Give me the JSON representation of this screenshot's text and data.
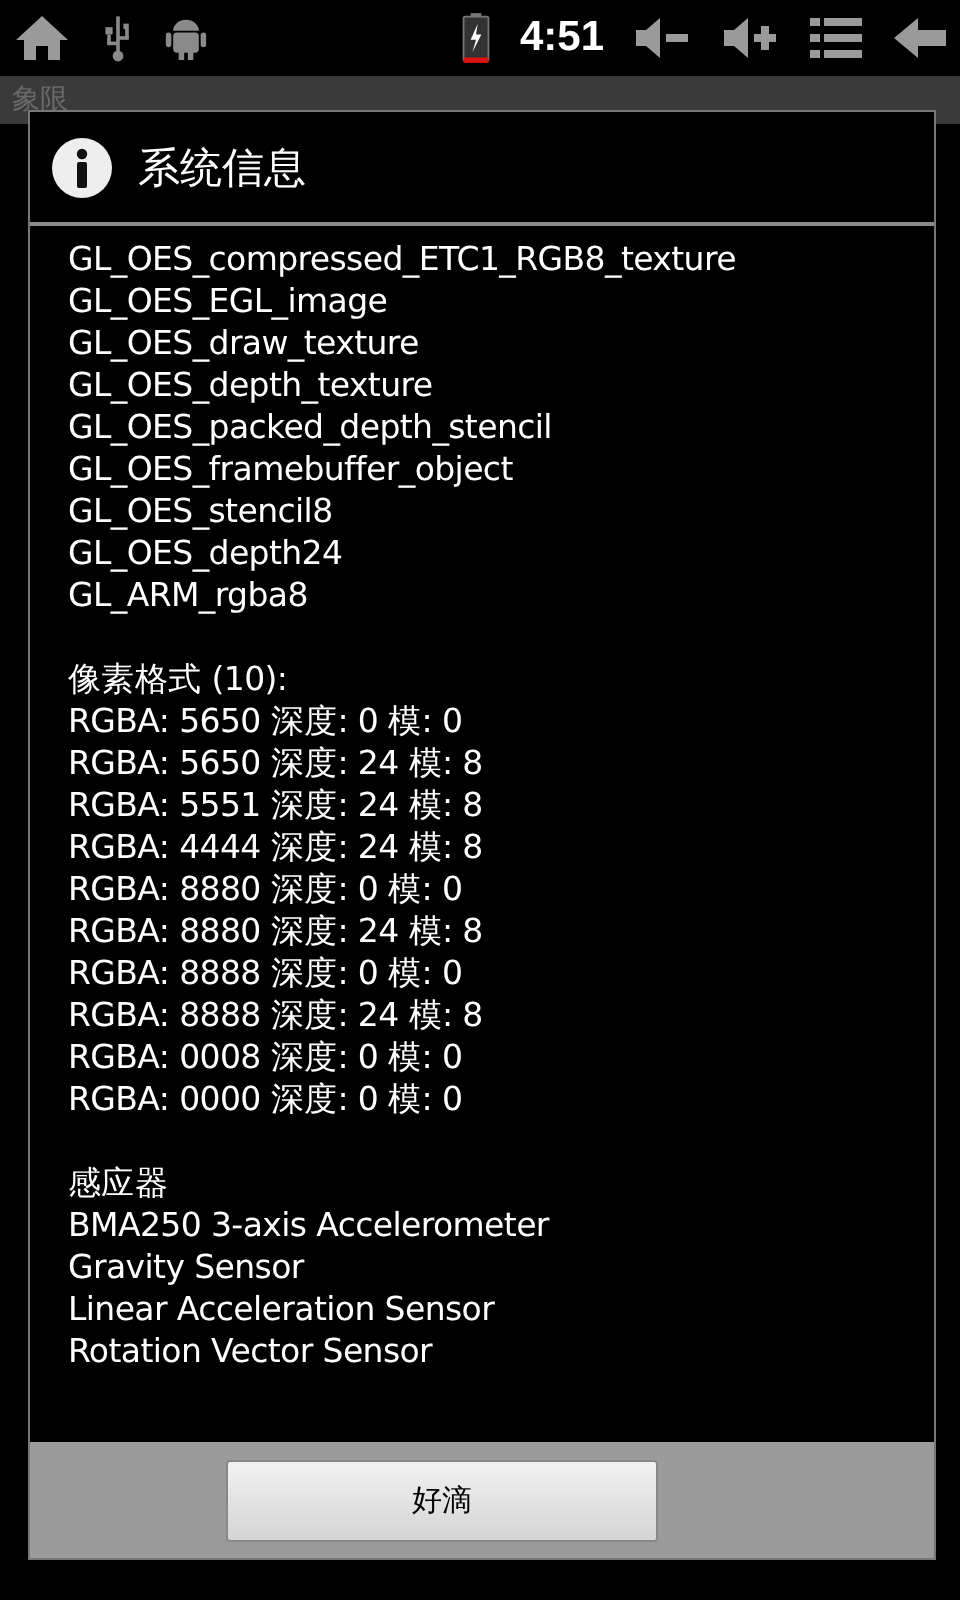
{
  "status_bar": {
    "time": "4:51"
  },
  "app_bar": {
    "title": "象限"
  },
  "dialog": {
    "title": "系统信息",
    "sections": [
      {
        "lines": [
          "GL_OES_compressed_ETC1_RGB8_texture",
          "GL_OES_EGL_image",
          "GL_OES_draw_texture",
          "GL_OES_depth_texture",
          "GL_OES_packed_depth_stencil",
          "GL_OES_framebuffer_object",
          "GL_OES_stencil8",
          "GL_OES_depth24",
          "GL_ARM_rgba8"
        ]
      },
      {
        "heading": "像素格式 (10):",
        "lines": [
          "RGBA: 5650 深度: 0 模: 0",
          "RGBA: 5650 深度: 24 模: 8",
          "RGBA: 5551 深度: 24 模: 8",
          "RGBA: 4444 深度: 24 模: 8",
          "RGBA: 8880 深度: 0 模: 0",
          "RGBA: 8880 深度: 24 模: 8",
          "RGBA: 8888 深度: 0 模: 0",
          "RGBA: 8888 深度: 24 模: 8",
          "RGBA: 0008 深度: 0 模: 0",
          "RGBA: 0000 深度: 0 模: 0"
        ]
      },
      {
        "heading": "感应器",
        "lines": [
          "BMA250 3-axis Accelerometer",
          "Gravity Sensor",
          "Linear Acceleration Sensor",
          "Rotation Vector Sensor"
        ]
      }
    ],
    "button": "好滴"
  }
}
